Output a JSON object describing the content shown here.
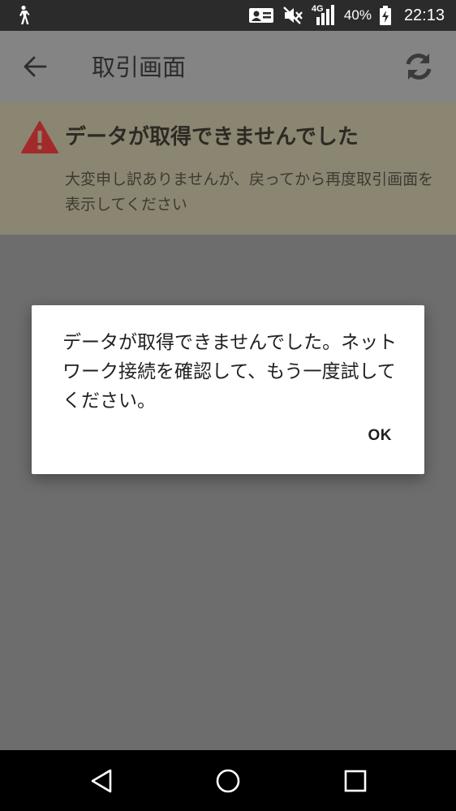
{
  "status_bar": {
    "battery_percent": "40%",
    "time": "22:13",
    "network_type": "4G",
    "icons": [
      "walking-person-icon",
      "sim-contact-icon",
      "mute-icon",
      "signal-icon",
      "battery-charging-icon"
    ]
  },
  "app_bar": {
    "title": "取引画面",
    "back_icon": "arrow-left-icon",
    "refresh_icon": "refresh-icon"
  },
  "error_banner": {
    "title": "データが取得できませんでした",
    "message": "大変申し訳ありませんが、戻ってから再度取引画面を表示してください",
    "icon": "warning-icon",
    "icon_color": "#a32a2a"
  },
  "dialog": {
    "message": "データが取得できませんでした。ネットワーク接続を確認して、もう一度試してください。",
    "ok_label": "OK"
  },
  "nav_bar": {
    "icons": [
      "nav-back-icon",
      "nav-home-icon",
      "nav-recent-icon"
    ]
  }
}
